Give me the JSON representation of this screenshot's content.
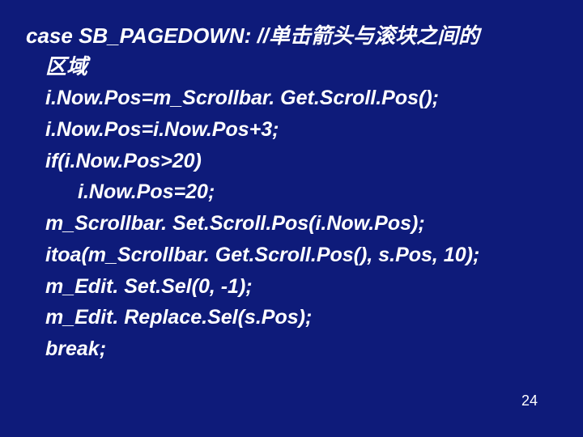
{
  "code": {
    "case_label": "case SB_PAGEDOWN:",
    "comment_head": "  //单击箭头与滚块之间的",
    "comment_tail": "区域",
    "l1": "i.Now.Pos=m_Scrollbar. Get.Scroll.Pos();",
    "l2": "i.Now.Pos=i.Now.Pos+3;",
    "l3": "if(i.Now.Pos>20)",
    "l4": "i.Now.Pos=20;",
    "l5": "m_Scrollbar. Set.Scroll.Pos(i.Now.Pos);",
    "l6": "itoa(m_Scrollbar. Get.Scroll.Pos(), s.Pos, 10);",
    "l7": "m_Edit. Set.Sel(0, -1);",
    "l8": "m_Edit. Replace.Sel(s.Pos);",
    "l9": "break;"
  },
  "page_number": "24"
}
